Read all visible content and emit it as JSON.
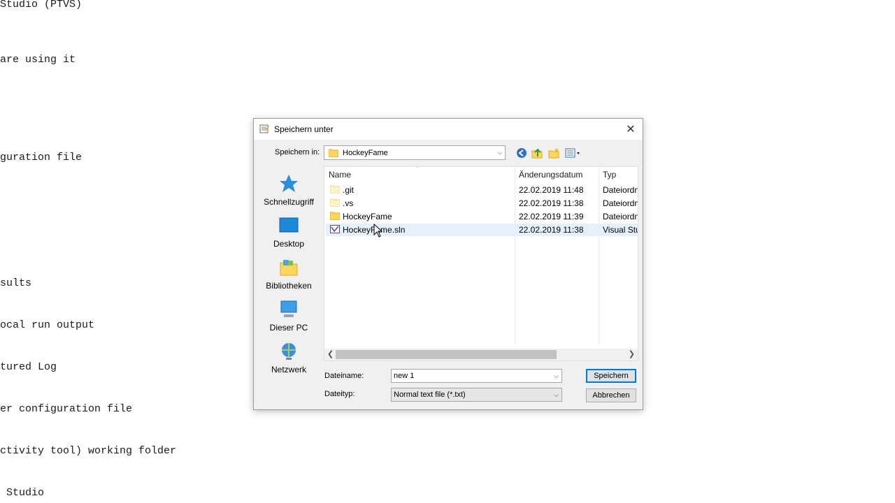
{
  "background": {
    "lines": [
      {
        "text": "Studio (PTVS)"
      },
      {
        "text": "are using it"
      },
      {
        "text": "guration file"
      },
      {
        "text": "sults"
      },
      {
        "text": "ocal run output"
      },
      {
        "text": "tured Log"
      },
      {
        "text": "er configuration file"
      },
      {
        "text": "ctivity tool) working folder"
      },
      {
        "text": " Studio"
      }
    ]
  },
  "dialog": {
    "title": "Speichern unter",
    "close_glyph": "✕",
    "save_in_label": "Speichern in:",
    "save_in_value": "HockeyFame",
    "places": [
      {
        "label": "Schnellzugriff",
        "icon": "star-icon"
      },
      {
        "label": "Desktop",
        "icon": "desktop-icon"
      },
      {
        "label": "Bibliotheken",
        "icon": "libraries-icon"
      },
      {
        "label": "Dieser PC",
        "icon": "computer-icon"
      },
      {
        "label": "Netzwerk",
        "icon": "network-icon"
      }
    ],
    "columns": {
      "name": "Name",
      "date": "Änderungsdatum",
      "type": "Typ"
    },
    "files": [
      {
        "name": ".git",
        "date": "22.02.2019 11:48",
        "type": "Dateiordn",
        "icon": "folder-faded-icon"
      },
      {
        "name": ".vs",
        "date": "22.02.2019 11:38",
        "type": "Dateiordn",
        "icon": "folder-faded-icon"
      },
      {
        "name": "HockeyFame",
        "date": "22.02.2019 11:39",
        "type": "Dateiordn",
        "icon": "folder-icon"
      },
      {
        "name": "HockeyFame.sln",
        "date": "22.02.2019 11:38",
        "type": "Visual Stu",
        "icon": "sln-file-icon"
      }
    ],
    "filename_label": "Dateiname:",
    "filename_value": "new 1",
    "filetype_label": "Dateityp:",
    "filetype_value": "Normal text file (*.txt)",
    "save_button": "Speichern",
    "cancel_button": "Abbrechen"
  },
  "colors": {
    "accent": "#0078d7",
    "selection": "#e5f0fb",
    "folder": "#ffd65c"
  }
}
